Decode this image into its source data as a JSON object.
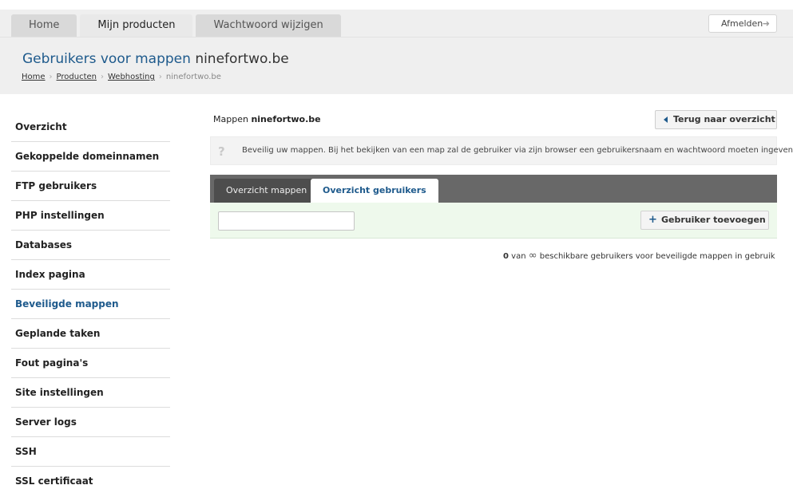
{
  "header": {
    "tabs": [
      {
        "label": "Home",
        "active": false
      },
      {
        "label": "Mijn producten",
        "active": true
      },
      {
        "label": "Wachtwoord wijzigen",
        "active": false
      }
    ],
    "logout_label": "Afmelden",
    "title_prefix": "Gebruikers voor mappen",
    "title_domain": "ninefortwo.be",
    "breadcrumb": {
      "home": "Home",
      "producten": "Producten",
      "webhosting": "Webhosting",
      "current": "ninefortwo.be"
    }
  },
  "sidebar": {
    "items": [
      {
        "label": "Overzicht"
      },
      {
        "label": "Gekoppelde domeinnamen"
      },
      {
        "label": "FTP gebruikers"
      },
      {
        "label": "PHP instellingen"
      },
      {
        "label": "Databases"
      },
      {
        "label": "Index pagina"
      },
      {
        "label": "Beveiligde mappen"
      },
      {
        "label": "Geplande taken"
      },
      {
        "label": "Fout pagina's"
      },
      {
        "label": "Site instellingen"
      },
      {
        "label": "Server logs"
      },
      {
        "label": "SSH"
      },
      {
        "label": "SSL certificaat"
      }
    ]
  },
  "main": {
    "label_prefix": "Mappen",
    "label_domain": "ninefortwo.be",
    "back_label": "Terug naar overzicht",
    "info_text": "Beveilig uw mappen. Bij het bekijken van een map zal de gebruiker via zijn browser een gebruikersnaam en wachtwoord moeten ingeven.",
    "tabs": [
      {
        "label": "Overzicht mappen"
      },
      {
        "label": "Overzicht gebruikers"
      }
    ],
    "search_value": "",
    "add_label": "Gebruiker toevoegen",
    "usage": {
      "count": "0",
      "van": "van",
      "infinity": "∞",
      "rest": "beschikbare gebruikers voor beveiligde mappen in gebruik"
    }
  }
}
